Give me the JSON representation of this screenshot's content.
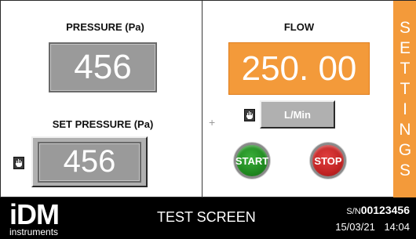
{
  "pressure": {
    "label": "PRESSURE (Pa)",
    "value": "456"
  },
  "set_pressure": {
    "label": "SET PRESSURE (Pa)",
    "value": "456"
  },
  "flow": {
    "label": "FLOW",
    "value": "250. 00",
    "unit_button": "L/Min"
  },
  "buttons": {
    "start": "START",
    "stop": "STOP"
  },
  "settings": {
    "letters": [
      "S",
      "E",
      "T",
      "T",
      "I",
      "N",
      "G",
      "S"
    ]
  },
  "footer": {
    "logo_main": "iDM",
    "logo_sub": "instruments",
    "title": "TEST SCREEN",
    "serial_prefix": "S/N",
    "serial_number": "00123456",
    "date": "15/03/21",
    "time": "14:04"
  },
  "colors": {
    "accent_orange": "#f39a3a",
    "display_grey": "#9a9a9a",
    "start_green": "#208a20",
    "stop_red": "#c22323"
  },
  "icons": {
    "lock_hand": "hand-icon",
    "crosshair": "plus"
  }
}
